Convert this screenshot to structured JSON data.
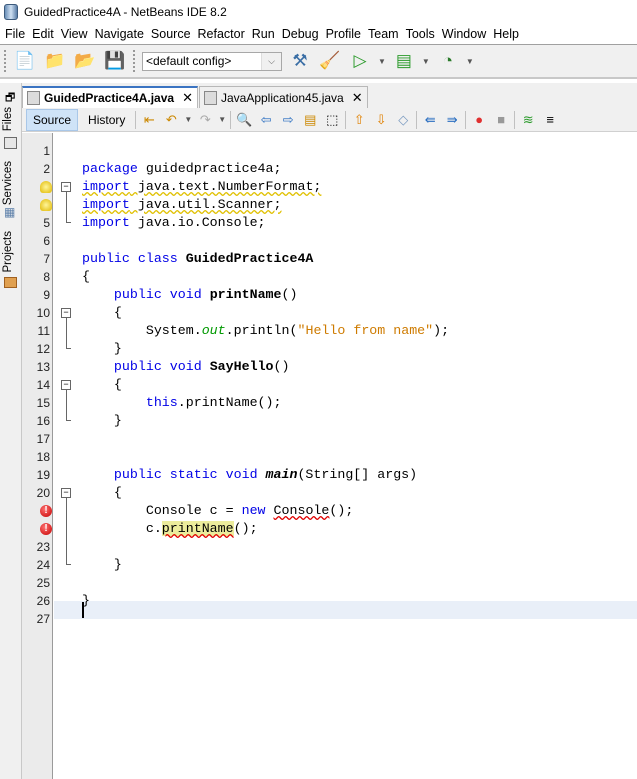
{
  "window": {
    "title": "GuidedPractice4A - NetBeans IDE 8.2"
  },
  "menu": [
    "File",
    "Edit",
    "View",
    "Navigate",
    "Source",
    "Refactor",
    "Run",
    "Debug",
    "Profile",
    "Team",
    "Tools",
    "Window",
    "Help"
  ],
  "toolbar": {
    "config": "<default config>"
  },
  "side_tabs": {
    "files": "Files",
    "services": "Services",
    "projects": "Projects"
  },
  "tabs": [
    {
      "label": "GuidedPractice4A.java",
      "active": true
    },
    {
      "label": "JavaApplication45.java",
      "active": false
    }
  ],
  "editor_toolbar": {
    "source": "Source",
    "history": "History"
  },
  "editor": {
    "lines": [
      {
        "n": "1",
        "tokens": []
      },
      {
        "n": "2",
        "tokens": [
          {
            "t": "package",
            "c": "kw"
          },
          {
            "t": " guidedpractice4a;"
          }
        ]
      },
      {
        "n": "3",
        "marker": "warning",
        "fold": "start",
        "tokens": [
          {
            "t": "import",
            "c": "kw uw"
          },
          {
            "t": " java.text.NumberFormat;",
            "c": "uw"
          }
        ]
      },
      {
        "n": "4",
        "marker": "warning",
        "tokens": [
          {
            "t": "import",
            "c": "kw uw"
          },
          {
            "t": " java.util.Scanner;",
            "c": "uw"
          }
        ]
      },
      {
        "n": "5",
        "tokens": [
          {
            "t": "import",
            "c": "kw"
          },
          {
            "t": " java.io.Console;"
          }
        ]
      },
      {
        "n": "6",
        "tokens": []
      },
      {
        "n": "7",
        "tokens": [
          {
            "t": "public class ",
            "c": "kw"
          },
          {
            "t": "GuidedPractice4A",
            "c": "bold"
          }
        ]
      },
      {
        "n": "8",
        "tokens": [
          {
            "t": "{"
          }
        ]
      },
      {
        "n": "9",
        "tokens": [
          {
            "t": "    "
          },
          {
            "t": "public void ",
            "c": "kw"
          },
          {
            "t": "printName",
            "c": "bold"
          },
          {
            "t": "()"
          }
        ]
      },
      {
        "n": "10",
        "fold": "start",
        "tokens": [
          {
            "t": "    {"
          }
        ]
      },
      {
        "n": "11",
        "tokens": [
          {
            "t": "        System."
          },
          {
            "t": "out",
            "c": "fld"
          },
          {
            "t": ".println("
          },
          {
            "t": "\"Hello from name\"",
            "c": "st"
          },
          {
            "t": ");"
          }
        ]
      },
      {
        "n": "12",
        "tokens": [
          {
            "t": "    }"
          }
        ]
      },
      {
        "n": "13",
        "tokens": [
          {
            "t": "    "
          },
          {
            "t": "public void ",
            "c": "kw"
          },
          {
            "t": "SayHello",
            "c": "bold"
          },
          {
            "t": "()"
          }
        ]
      },
      {
        "n": "14",
        "fold": "start",
        "tokens": [
          {
            "t": "    {"
          }
        ]
      },
      {
        "n": "15",
        "tokens": [
          {
            "t": "        "
          },
          {
            "t": "this",
            "c": "kw"
          },
          {
            "t": ".printName();"
          }
        ]
      },
      {
        "n": "16",
        "tokens": [
          {
            "t": "    }"
          }
        ]
      },
      {
        "n": "17",
        "tokens": []
      },
      {
        "n": "18",
        "tokens": []
      },
      {
        "n": "19",
        "tokens": [
          {
            "t": "    "
          },
          {
            "t": "public static void ",
            "c": "kw"
          },
          {
            "t": "main",
            "c": "bold it"
          },
          {
            "t": "(String[] args)"
          }
        ]
      },
      {
        "n": "20",
        "fold": "start",
        "tokens": [
          {
            "t": "    {"
          }
        ]
      },
      {
        "n": "21",
        "marker": "error",
        "tokens": [
          {
            "t": "        Console c = "
          },
          {
            "t": "new",
            "c": "kw"
          },
          {
            "t": " "
          },
          {
            "t": "Console",
            "c": "ue"
          },
          {
            "t": "();"
          }
        ]
      },
      {
        "n": "22",
        "marker": "error",
        "tokens": [
          {
            "t": "        c."
          },
          {
            "t": "printName",
            "c": "ue hl"
          },
          {
            "t": "();"
          }
        ]
      },
      {
        "n": "23",
        "tokens": []
      },
      {
        "n": "24",
        "tokens": [
          {
            "t": "    }"
          }
        ]
      },
      {
        "n": "25",
        "tokens": []
      },
      {
        "n": "26",
        "tokens": [
          {
            "t": "}"
          }
        ]
      },
      {
        "n": "27",
        "tokens": []
      }
    ]
  }
}
